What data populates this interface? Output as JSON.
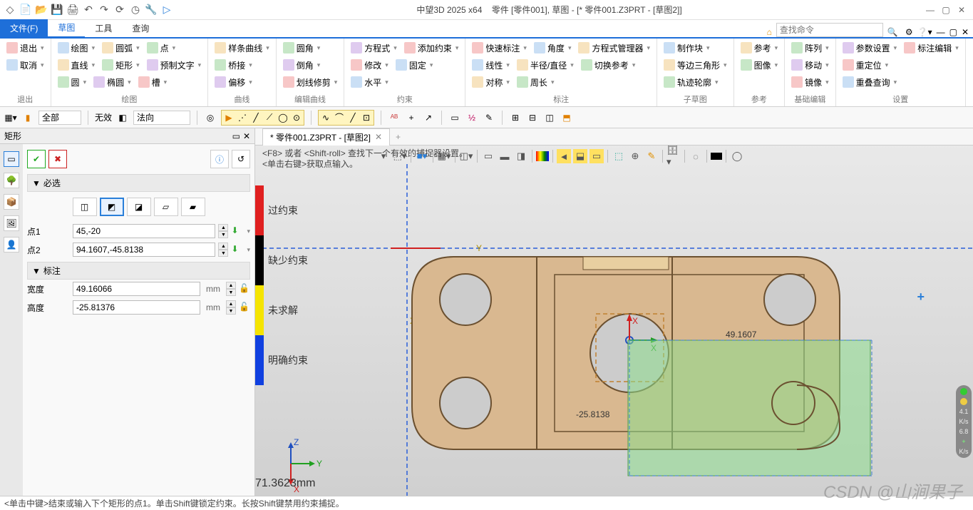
{
  "titlebar": {
    "app": "中望3D 2025 x64",
    "doc": "零件 [零件001], 草图 - [* 零件001.Z3PRT - [草图2]]"
  },
  "menu": {
    "file": "文件(F)",
    "tabs": [
      "草图",
      "工具",
      "查询"
    ],
    "search_placeholder": "查找命令"
  },
  "ribbon": {
    "groups": [
      {
        "label": "退出",
        "items": [
          [
            "退出"
          ],
          [
            "取消"
          ]
        ]
      },
      {
        "label": "绘图",
        "items": [
          [
            "绘图",
            "圆弧",
            "点"
          ],
          [
            "直线",
            "矩形",
            "预制文字"
          ],
          [
            "圆",
            "椭圆",
            "槽"
          ]
        ]
      },
      {
        "label": "曲线",
        "items": [
          [
            "样条曲线"
          ],
          [
            "桥接"
          ],
          [
            "偏移"
          ]
        ]
      },
      {
        "label": "编辑曲线",
        "items": [
          [
            "圆角"
          ],
          [
            "倒角"
          ],
          [
            "划线修剪"
          ]
        ]
      },
      {
        "label": "约束",
        "items": [
          [
            "方程式",
            "添加约束"
          ],
          [
            "修改",
            "固定"
          ],
          [
            "水平"
          ]
        ]
      },
      {
        "label": "标注",
        "items": [
          [
            "快速标注",
            "角度",
            "方程式管理器"
          ],
          [
            "线性",
            "半径/直径",
            "切换参考"
          ],
          [
            "对称",
            "周长"
          ]
        ]
      },
      {
        "label": "子草图",
        "items": [
          [
            "制作块"
          ],
          [
            "等边三角形"
          ],
          [
            "轨迹轮廓"
          ]
        ]
      },
      {
        "label": "参考",
        "items": [
          [
            "参考"
          ],
          [
            "图像"
          ]
        ]
      },
      {
        "label": "基础编辑",
        "items": [
          [
            "阵列"
          ],
          [
            "移动"
          ],
          [
            "镜像"
          ]
        ]
      },
      {
        "label": "设置",
        "items": [
          [
            "参数设置",
            "标注编辑"
          ],
          [
            "重定位"
          ],
          [
            "重叠查询"
          ]
        ]
      }
    ]
  },
  "subbar": {
    "combo1": "全部",
    "none": "无效",
    "combo2": "法向"
  },
  "panel": {
    "title": "矩形",
    "section1": "必选",
    "point1_label": "点1",
    "point1_value": "45,-20",
    "point2_label": "点2",
    "point2_value": "94.1607,-45.8138",
    "section2": "标注",
    "width_label": "宽度",
    "width_value": "49.16066",
    "height_label": "高度",
    "height_value": "-25.81376",
    "unit": "mm"
  },
  "doc_tab": "* 零件001.Z3PRT - [草图2]",
  "hint1": "<F8> 或者 <Shift-roll> 查找下一个有效的捕捉器设置。",
  "hint2": "<单击右键>获取点输入。",
  "legend": [
    {
      "color": "#e02020",
      "label": "过约束"
    },
    {
      "color": "#000000",
      "label": "缺少约束"
    },
    {
      "color": "#f5e400",
      "label": "未求解"
    },
    {
      "color": "#1040e0",
      "label": "明确约束"
    }
  ],
  "dim1": "49.1607",
  "dim2": "-25.8138",
  "axis_y": "Y",
  "axis_x": "X",
  "axis_z": "Z",
  "measure": "71.3623mm",
  "perf": {
    "v1": "4.1",
    "u1": "K/s",
    "v2": "6.8",
    "u2": "K/s"
  },
  "status": "<单击中键>结束或输入下个矩形的点1。单击Shift键锁定约束。长按Shift键禁用约束捕捉。",
  "watermark": "CSDN @山涧果子"
}
